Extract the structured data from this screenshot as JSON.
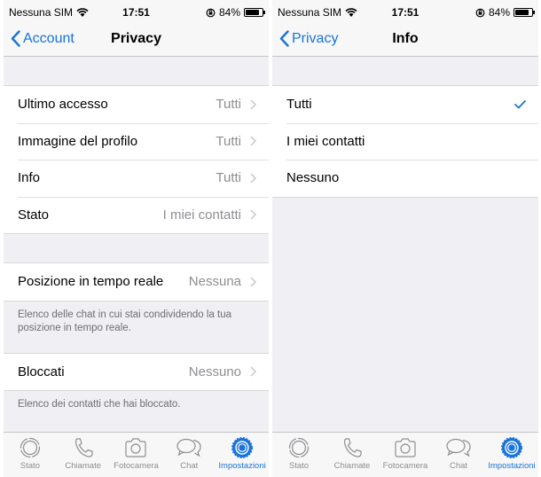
{
  "status_bar": {
    "carrier": "Nessuna SIM",
    "time": "17:51",
    "battery_percent": "84%",
    "battery_level": 0.84
  },
  "left_screen": {
    "nav": {
      "back_label": "Account",
      "title": "Privacy"
    },
    "groups": [
      {
        "rows": [
          {
            "label": "Ultimo accesso",
            "value": "Tutti"
          },
          {
            "label": "Immagine del profilo",
            "value": "Tutti"
          },
          {
            "label": "Info",
            "value": "Tutti"
          },
          {
            "label": "Stato",
            "value": "I miei contatti"
          }
        ]
      },
      {
        "rows": [
          {
            "label": "Posizione in tempo reale",
            "value": "Nessuna"
          }
        ],
        "footer": "Elenco delle chat in cui stai condividendo la tua posizione in tempo reale."
      },
      {
        "rows": [
          {
            "label": "Bloccati",
            "value": "Nessuno"
          }
        ],
        "footer": "Elenco dei contatti che hai bloccato."
      }
    ]
  },
  "right_screen": {
    "nav": {
      "back_label": "Privacy",
      "title": "Info"
    },
    "options": [
      {
        "label": "Tutti",
        "selected": true
      },
      {
        "label": "I miei contatti",
        "selected": false
      },
      {
        "label": "Nessuno",
        "selected": false
      }
    ]
  },
  "tab_bar": {
    "items": [
      {
        "label": "Stato",
        "icon": "status-icon"
      },
      {
        "label": "Chiamate",
        "icon": "phone-icon"
      },
      {
        "label": "Fotocamera",
        "icon": "camera-icon"
      },
      {
        "label": "Chat",
        "icon": "chat-icon"
      },
      {
        "label": "Impostazioni",
        "icon": "settings-icon",
        "active": true
      }
    ]
  },
  "colors": {
    "accent": "#1a73d9",
    "background": "#efeff4",
    "secondary_text": "#8e8e93"
  }
}
